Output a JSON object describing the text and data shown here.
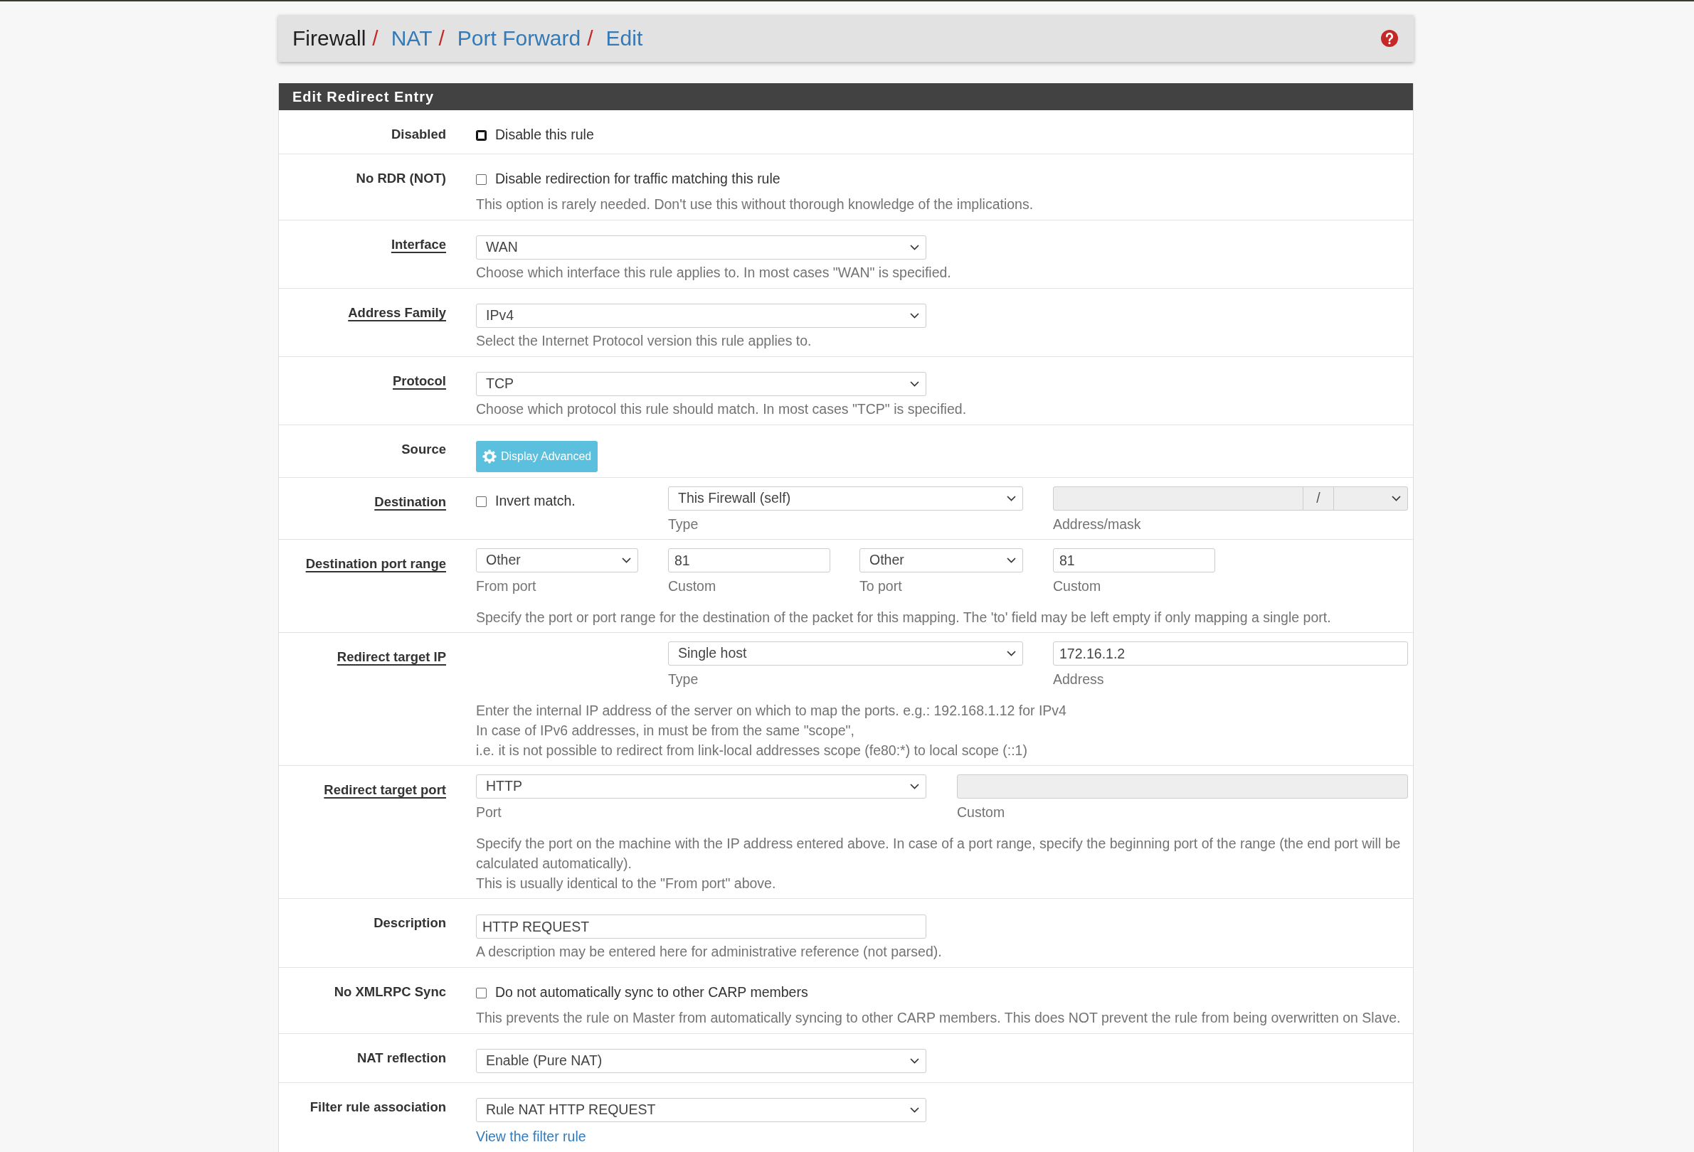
{
  "breadcrumb": [
    {
      "label": "Firewall",
      "link": false,
      "separator": "/"
    },
    {
      "label": "NAT",
      "link": true,
      "separator": "/"
    },
    {
      "label": "Port Forward",
      "link": true,
      "separator": "/"
    },
    {
      "label": "Edit",
      "link": true
    }
  ],
  "panel": {
    "title": "Edit Redirect Entry",
    "rows": [
      {
        "label": "Disabled",
        "help_link": false,
        "kind": "single",
        "fields": [
          {
            "kind": "checkbox",
            "text": "Disable this rule",
            "checked": false,
            "focused": true
          }
        ]
      },
      {
        "label": "No RDR (NOT)",
        "help_link": false,
        "kind": "single",
        "fields": [
          {
            "kind": "checkbox",
            "text": "Disable redirection for traffic matching this rule",
            "checked": false,
            "focused": false
          }
        ],
        "help": [
          "This option is rarely needed. Don't use this without thorough knowledge of the implications."
        ]
      },
      {
        "label": "Interface",
        "help_link": true,
        "kind": "single",
        "fields": [
          {
            "kind": "select",
            "value": "WAN",
            "disabled": false
          }
        ],
        "help": [
          "Choose which interface this rule applies to. In most cases \"WAN\" is specified."
        ]
      },
      {
        "label": "Address Family",
        "help_link": true,
        "kind": "single",
        "fields": [
          {
            "kind": "select",
            "value": "IPv4",
            "disabled": false
          }
        ],
        "help": [
          "Select the Internet Protocol version this rule applies to."
        ]
      },
      {
        "label": "Protocol",
        "help_link": true,
        "kind": "single",
        "fields": [
          {
            "kind": "select",
            "value": "TCP",
            "disabled": false
          }
        ],
        "help": [
          "Choose which protocol this rule should match. In most cases \"TCP\" is specified."
        ]
      },
      {
        "label": "Source",
        "help_link": false,
        "kind": "single",
        "fields": [
          {
            "kind": "button",
            "text": "Display Advanced"
          }
        ]
      },
      {
        "label": "Destination",
        "help_link": true,
        "kind": "destination",
        "fields": [
          {
            "kind": "checkbox",
            "text": "Invert match.",
            "checked": false,
            "focused": false
          },
          {
            "kind": "select",
            "value": "This Firewall (self)",
            "disabled": false,
            "caption": "Type"
          },
          {
            "kind": "address_mask",
            "disabled": true,
            "separator": "/",
            "caption": "Address/mask"
          }
        ]
      },
      {
        "label": "Destination port range",
        "help_link": true,
        "kind": "port_range",
        "fields": [
          {
            "kind": "select",
            "value": "Other",
            "disabled": false,
            "caption": "From port"
          },
          {
            "kind": "input",
            "value": "81",
            "disabled": false,
            "caption": "Custom"
          },
          {
            "kind": "select",
            "value": "Other",
            "disabled": false,
            "caption": "To port"
          },
          {
            "kind": "input",
            "value": "81",
            "disabled": false,
            "caption": "Custom"
          }
        ],
        "help": [
          "Specify the port or port range for the destination of the packet for this mapping. The 'to' field may be left empty if only mapping a single port."
        ]
      },
      {
        "label": "Redirect target IP",
        "help_link": true,
        "kind": "target_ip",
        "fields": [
          {
            "kind": "select",
            "value": "Single host",
            "disabled": false,
            "caption": "Type"
          },
          {
            "kind": "input",
            "value": "172.16.1.2",
            "disabled": false,
            "caption": "Address"
          }
        ],
        "help": [
          "Enter the internal IP address of the server on which to map the ports. e.g.: 192.168.1.12 for IPv4",
          "In case of IPv6 addresses, in must be from the same \"scope\",",
          "i.e. it is not possible to redirect from link-local addresses scope (fe80:*) to local scope (::1)"
        ]
      },
      {
        "label": "Redirect target port",
        "help_link": true,
        "kind": "target_port",
        "fields": [
          {
            "kind": "select",
            "value": "HTTP",
            "disabled": false,
            "caption": "Port"
          },
          {
            "kind": "input",
            "disabled": true,
            "caption": "Custom"
          }
        ],
        "help": [
          "Specify the port on the machine with the IP address entered above. In case of a port range, specify the beginning port of the range (the end port will be calculated automatically).",
          "This is usually identical to the \"From port\" above."
        ]
      },
      {
        "label": "Description",
        "help_link": false,
        "kind": "single",
        "fields": [
          {
            "kind": "input",
            "value": "HTTP REQUEST",
            "disabled": false
          }
        ],
        "help": [
          "A description may be entered here for administrative reference (not parsed)."
        ]
      },
      {
        "label": "No XMLRPC Sync",
        "help_link": false,
        "kind": "single",
        "fields": [
          {
            "kind": "checkbox",
            "text": "Do not automatically sync to other CARP members",
            "checked": false,
            "focused": false
          }
        ],
        "help": [
          "This prevents the rule on Master from automatically syncing to other CARP members. This does NOT prevent the rule from being overwritten on Slave."
        ]
      },
      {
        "label": "NAT reflection",
        "help_link": false,
        "kind": "single",
        "fields": [
          {
            "kind": "select",
            "value": "Enable (Pure NAT)",
            "disabled": false
          }
        ]
      },
      {
        "label": "Filter rule association",
        "help_link": false,
        "kind": "single",
        "fields": [
          {
            "kind": "select",
            "value": "Rule NAT HTTP REQUEST",
            "disabled": false
          }
        ],
        "link": "View the filter rule"
      }
    ]
  }
}
